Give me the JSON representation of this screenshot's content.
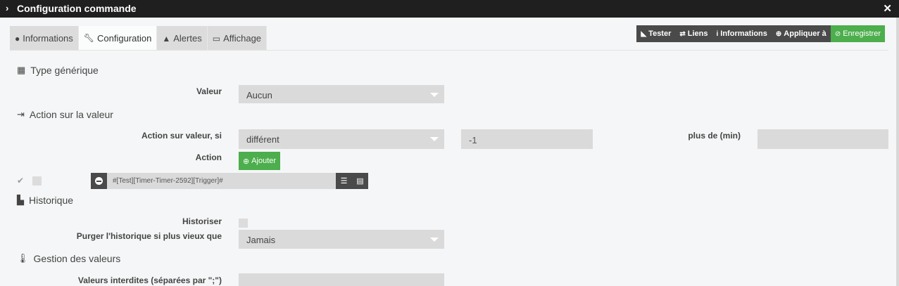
{
  "window": {
    "title": "Configuration commande",
    "chevron_icon": "›",
    "close_icon": "✕"
  },
  "tabs": [
    {
      "label": "Informations",
      "icon": "ⓘ"
    },
    {
      "label": "Configuration",
      "icon": "🔧"
    },
    {
      "label": "Alertes",
      "icon": "⚠"
    },
    {
      "label": "Affichage",
      "icon": "🖵"
    }
  ],
  "actions": [
    {
      "label": "Tester",
      "icon": "rss-icon"
    },
    {
      "label": "Liens",
      "icon": "exchange-icon"
    },
    {
      "label": "Informations",
      "icon": "info-icon"
    },
    {
      "label": "Appliquer à",
      "icon": "plus-circle-icon"
    },
    {
      "label": "Enregistrer",
      "icon": "check-circle-icon"
    }
  ],
  "sections": {
    "type_generique": "Type générique",
    "action_valeur": "Action sur la valeur",
    "historique": "Historique",
    "gestion_valeurs": "Gestion des valeurs"
  },
  "fields": {
    "valeur_label": "Valeur",
    "valeur_value": "Aucun",
    "action_sur_valeur_label": "Action sur valeur, si",
    "action_sur_valeur_operator": "différent",
    "action_sur_valeur_value": "-1",
    "plus_de_label": "plus de (min)",
    "plus_de_value": "",
    "action_label": "Action",
    "ajouter_label": "Ajouter",
    "command": "#[Test][Timer-Timer-2592][Trigger]#",
    "historiser_label": "Historiser",
    "purger_label": "Purger l'historique si plus vieux que",
    "purger_value": "Jamais",
    "valeurs_interdites_label": "Valeurs interdites (séparées par \";\")",
    "valeurs_interdites_value": ""
  },
  "colors": {
    "titlebar": "#1f1f1f",
    "accent_green": "#4cae4c",
    "dark_button": "#4a4a4a"
  }
}
